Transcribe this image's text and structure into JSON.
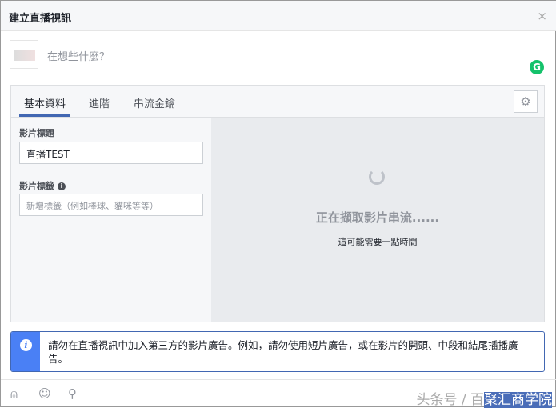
{
  "dialog": {
    "title": "建立直播視訊",
    "close": "×"
  },
  "composer": {
    "placeholder": "在想些什麼？",
    "grammarly": "G"
  },
  "tabs": [
    {
      "label": "基本資料"
    },
    {
      "label": "進階"
    },
    {
      "label": "串流金鑰"
    }
  ],
  "settings_icon": "⚙",
  "form": {
    "title_label": "影片標題",
    "title_value": "直播TEST",
    "tags_label": "影片標籤",
    "tags_placeholder": "新增標籤（例如棒球、貓咪等等）",
    "info": "i"
  },
  "preview": {
    "loading": "正在擷取影片串流......",
    "sub": "這可能需要一點時間"
  },
  "notice": {
    "icon": "i",
    "text": "請勿在直播視訊中加入第三方的影片廣告。例如，請勿使用短片廣告，或在影片的開頭、中段和結尾插播廣告。"
  },
  "footer": {
    "icons": [
      "tag-people-icon",
      "emoji-icon",
      "location-icon"
    ]
  },
  "watermark": {
    "prefix": "头条号 / 百",
    "name": "聚汇商学院"
  }
}
